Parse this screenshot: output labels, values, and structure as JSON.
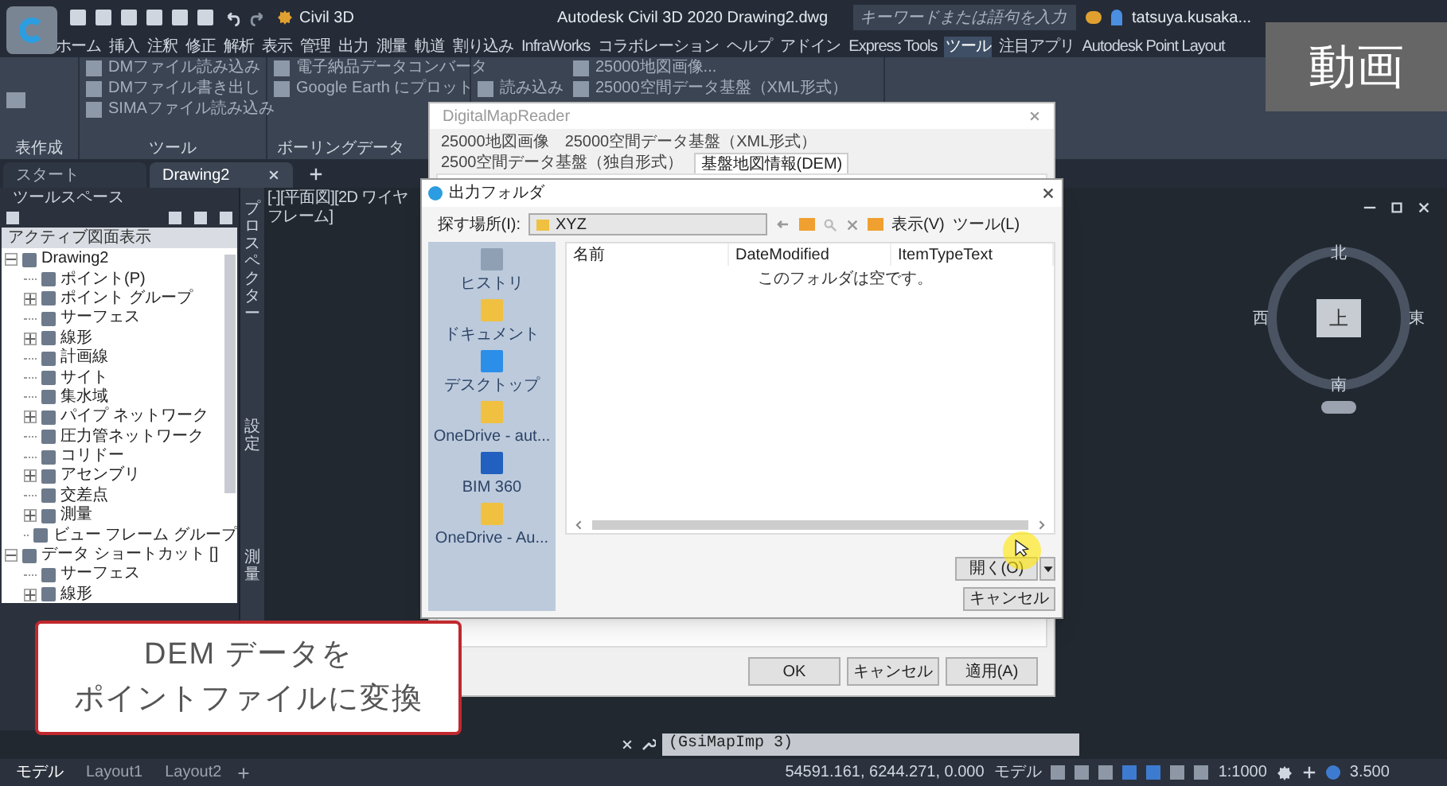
{
  "app": {
    "title": "Autodesk Civil 3D 2020  Drawing2.dwg",
    "workspace": "Civil 3D",
    "search": {
      "placeholder": "キーワードまたは語句を入力"
    },
    "user": "tatsuya.kusaka..."
  },
  "ribbon_tabs": [
    {
      "label": "ホーム",
      "selected": false
    },
    {
      "label": "挿入",
      "selected": false
    },
    {
      "label": "注釈",
      "selected": false
    },
    {
      "label": "修正",
      "selected": false
    },
    {
      "label": "解析",
      "selected": false
    },
    {
      "label": "表示",
      "selected": false
    },
    {
      "label": "管理",
      "selected": false
    },
    {
      "label": "出力",
      "selected": false
    },
    {
      "label": "測量",
      "selected": false
    },
    {
      "label": "軌道",
      "selected": false
    },
    {
      "label": "割り込み",
      "selected": false
    },
    {
      "label": "InfraWorks",
      "selected": false
    },
    {
      "label": "コラボレーション",
      "selected": false
    },
    {
      "label": "ヘルプ",
      "selected": false
    },
    {
      "label": "アドイン",
      "selected": false
    },
    {
      "label": "Express Tools",
      "selected": false
    },
    {
      "label": "ツール",
      "selected": true
    },
    {
      "label": "注目アプリ",
      "selected": false
    },
    {
      "label": "Autodesk Point Layout",
      "selected": false
    }
  ],
  "ribbon_panels": [
    {
      "title": "表作成"
    },
    {
      "title": "ツール",
      "buttons": [
        "DMファイル読み込み",
        "DMファイル書き出し",
        "SIMAファイル読み込み"
      ]
    },
    {
      "title": "ボーリングデータ",
      "buttons": [
        "電子納品データコンバータ",
        "Google Earth にプロット"
      ]
    },
    {
      "buttons": [
        "読み込み",
        "25000地図画像...",
        "25000空間データ基盤（XML形式）"
      ]
    }
  ],
  "doc_tabs": [
    {
      "label": "スタート",
      "selected": false
    },
    {
      "label": "Drawing2",
      "selected": true
    }
  ],
  "toolspace": {
    "title": "ツールスペース",
    "view": "アクティブ図面表示",
    "tree": [
      {
        "label": "Drawing2",
        "kind": "node",
        "expanded": true,
        "children": [
          {
            "label": "ポイント(P)",
            "kind": "leaf"
          },
          {
            "label": "ポイント グループ",
            "kind": "node",
            "expanded": false
          },
          {
            "label": "サーフェス",
            "kind": "leaf"
          },
          {
            "label": "線形",
            "kind": "node",
            "expanded": false
          },
          {
            "label": "計画線",
            "kind": "leaf"
          },
          {
            "label": "サイト",
            "kind": "leaf"
          },
          {
            "label": "集水域",
            "kind": "leaf"
          },
          {
            "label": "パイプ ネットワーク",
            "kind": "node",
            "expanded": false
          },
          {
            "label": "圧力管ネットワーク",
            "kind": "leaf"
          },
          {
            "label": "コリドー",
            "kind": "leaf"
          },
          {
            "label": "アセンブリ",
            "kind": "node",
            "expanded": false
          },
          {
            "label": "交差点",
            "kind": "leaf"
          },
          {
            "label": "測量",
            "kind": "node",
            "expanded": false
          },
          {
            "label": "ビュー フレーム グループ",
            "kind": "leaf"
          }
        ]
      },
      {
        "label": "データ ショートカット []",
        "kind": "node",
        "expanded": true,
        "children": [
          {
            "label": "サーフェス",
            "kind": "leaf"
          },
          {
            "label": "線形",
            "kind": "node",
            "expanded": false
          }
        ]
      }
    ]
  },
  "side_tabs": [
    "プロスペクター",
    "設定",
    "測量"
  ],
  "viewport_label": "[-][平面図][2D ワイヤフレーム]",
  "viewcube": {
    "north": "北",
    "west": "西",
    "top": "上",
    "east": "東",
    "south": "南"
  },
  "map_reader": {
    "title": "DigitalMapReader",
    "tabs": [
      {
        "label": "25000地図画像",
        "selected": false
      },
      {
        "label": "25000空間データ基盤（XML形式）",
        "selected": false
      },
      {
        "label": "2500空間データ基盤（独自形式）",
        "selected": false
      },
      {
        "label": "基盤地図情報(DEM)",
        "selected": true
      }
    ],
    "buttons": [
      "OK",
      "キャンセル",
      "適用(A)"
    ]
  },
  "folder_dialog": {
    "title": "出力フォルダ",
    "look_in_label": "探す場所(I):",
    "look_in": "XYZ",
    "view_menu": "表示(V)",
    "tools_menu": "ツール(L)",
    "places": [
      "ヒストリ",
      "ドキュメント",
      "デスクトップ",
      "OneDrive - aut...",
      "BIM 360",
      "OneDrive - Au..."
    ],
    "columns": [
      "名前",
      "DateModified",
      "ItemTypeText"
    ],
    "empty_message": "このフォルダは空です。",
    "open_button": "開く(O)",
    "cancel_button": "キャンセル"
  },
  "command_line": "(GsiMapImp 3)",
  "status_bar": {
    "layouts": [
      {
        "label": "モデル",
        "selected": true
      },
      {
        "label": "Layout1",
        "selected": false
      },
      {
        "label": "Layout2",
        "selected": false
      }
    ],
    "coordinates": "54591.161, 6244.271, 0.000",
    "space": "モデル",
    "scale": "1:1000",
    "value": "3.500"
  },
  "caption": [
    "DEM データを",
    "ポイントファイルに変換"
  ],
  "video_badge": "動画"
}
